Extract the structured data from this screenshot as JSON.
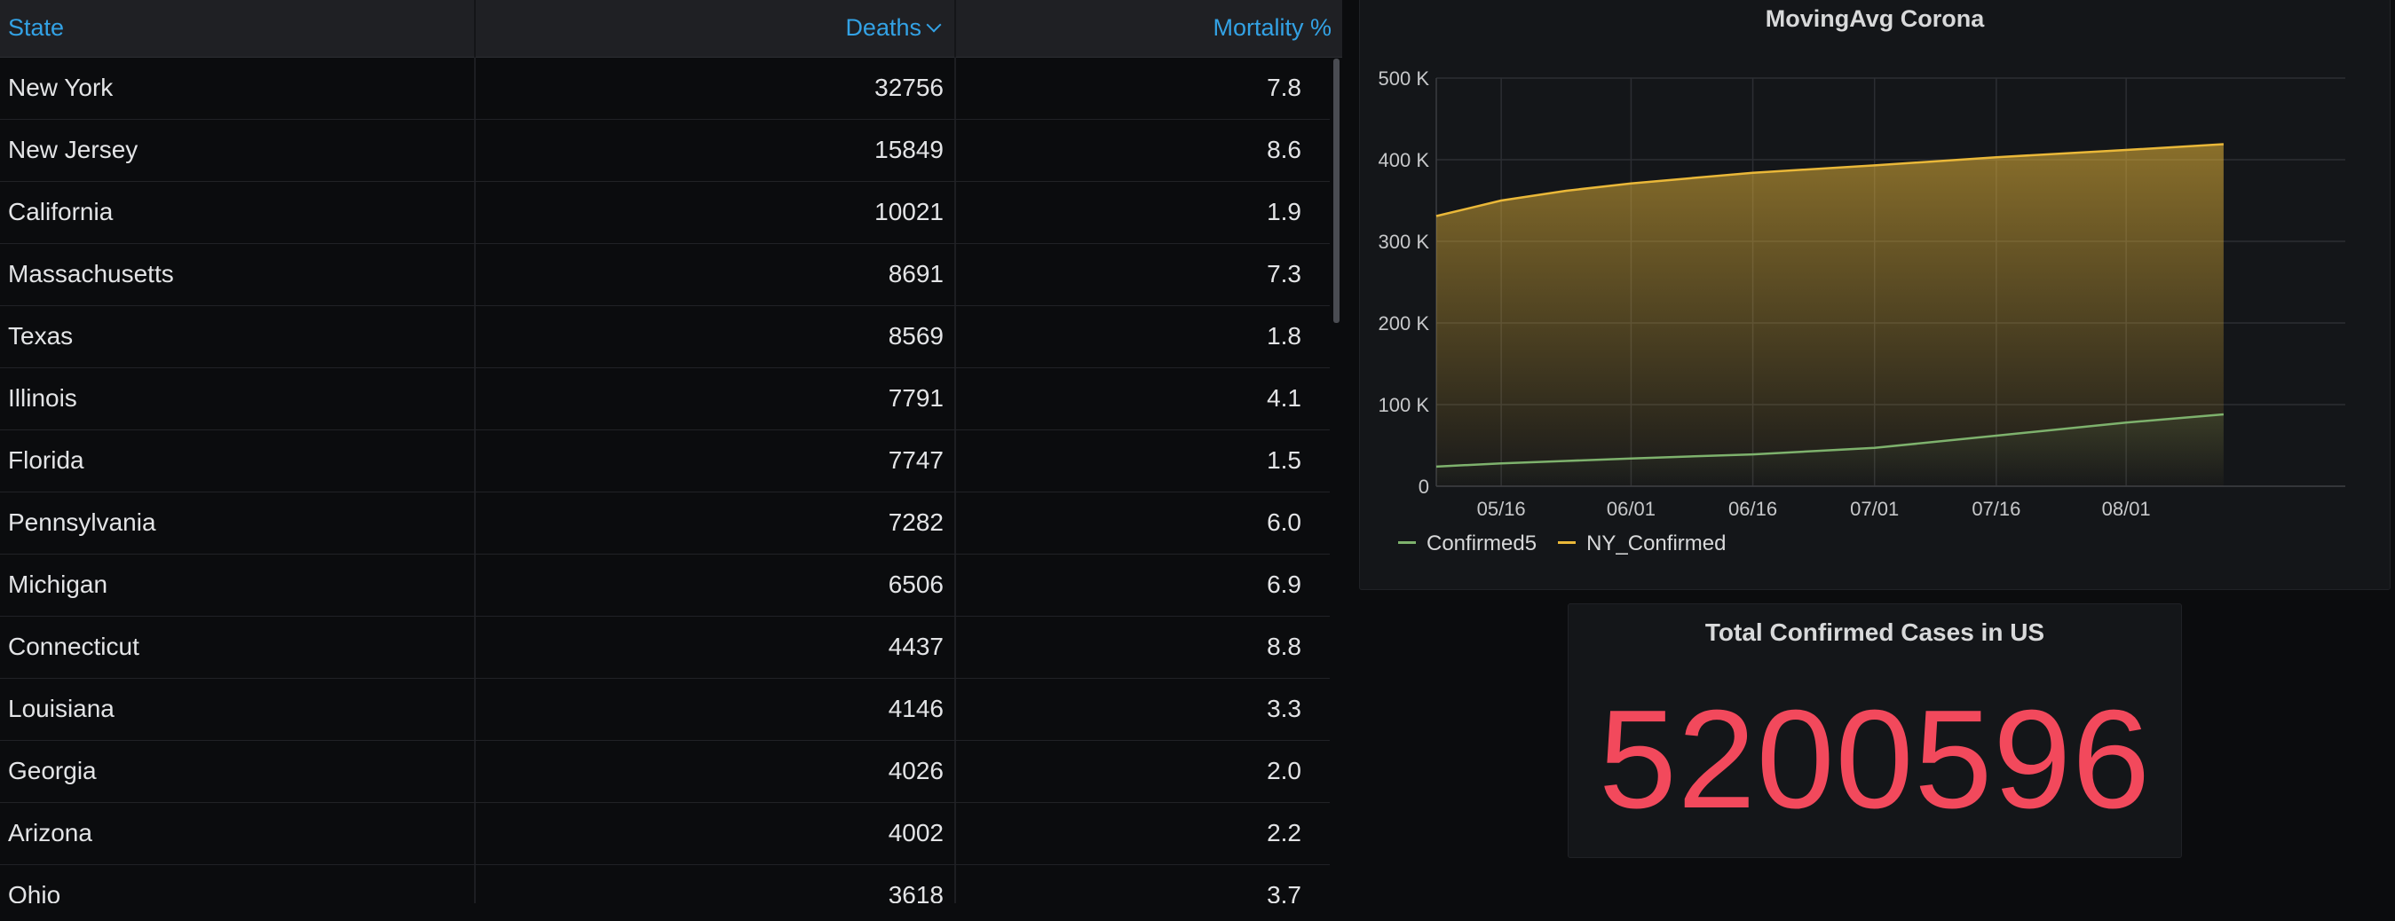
{
  "table": {
    "columns": {
      "state": "State",
      "deaths": "Deaths",
      "mortality": "Mortality %"
    },
    "sort_column": "Deaths",
    "sort_direction": "descending",
    "rows": [
      {
        "state": "New York",
        "deaths": "32756",
        "mortality": "7.8"
      },
      {
        "state": "New Jersey",
        "deaths": "15849",
        "mortality": "8.6"
      },
      {
        "state": "California",
        "deaths": "10021",
        "mortality": "1.9"
      },
      {
        "state": "Massachusetts",
        "deaths": "8691",
        "mortality": "7.3"
      },
      {
        "state": "Texas",
        "deaths": "8569",
        "mortality": "1.8"
      },
      {
        "state": "Illinois",
        "deaths": "7791",
        "mortality": "4.1"
      },
      {
        "state": "Florida",
        "deaths": "7747",
        "mortality": "1.5"
      },
      {
        "state": "Pennsylvania",
        "deaths": "7282",
        "mortality": "6.0"
      },
      {
        "state": "Michigan",
        "deaths": "6506",
        "mortality": "6.9"
      },
      {
        "state": "Connecticut",
        "deaths": "4437",
        "mortality": "8.8"
      },
      {
        "state": "Louisiana",
        "deaths": "4146",
        "mortality": "3.3"
      },
      {
        "state": "Georgia",
        "deaths": "4026",
        "mortality": "2.0"
      },
      {
        "state": "Arizona",
        "deaths": "4002",
        "mortality": "2.2"
      },
      {
        "state": "Ohio",
        "deaths": "3618",
        "mortality": "3.7"
      }
    ]
  },
  "chart_panel": {
    "title": "MovingAvg Corona"
  },
  "chart_data": {
    "type": "area",
    "title": "MovingAvg Corona",
    "x_tick_labels": [
      "05/16",
      "06/01",
      "06/16",
      "07/01",
      "07/16",
      "08/01"
    ],
    "x_ticks": [
      "2020-05-16",
      "2020-06-01",
      "2020-06-16",
      "2020-07-01",
      "2020-07-16",
      "2020-08-01"
    ],
    "xlim": [
      "2020-05-08",
      "2020-08-28"
    ],
    "y_tick_labels": [
      "0",
      "100 K",
      "200 K",
      "300 K",
      "400 K",
      "500 K"
    ],
    "y_ticks": [
      0,
      100000,
      200000,
      300000,
      400000,
      500000
    ],
    "ylim": [
      0,
      500000
    ],
    "grid": true,
    "legend_position": "bottom-left",
    "x": [
      "2020-05-08",
      "2020-05-16",
      "2020-05-24",
      "2020-06-01",
      "2020-06-16",
      "2020-07-01",
      "2020-07-16",
      "2020-08-01",
      "2020-08-13"
    ],
    "series": [
      {
        "name": "NY_Confirmed",
        "color": "#eab839",
        "fill": true,
        "values": [
          331000,
          350000,
          362000,
          371000,
          384000,
          393000,
          403000,
          412000,
          419000
        ]
      },
      {
        "name": "Confirmed5",
        "color": "#7eb26d",
        "fill": false,
        "values": [
          24000,
          28000,
          31000,
          34000,
          39000,
          47000,
          62000,
          78000,
          88000
        ]
      }
    ]
  },
  "stat_panel": {
    "title": "Total Confirmed Cases in US",
    "value": "5200596",
    "value_color": "#f2495c"
  }
}
